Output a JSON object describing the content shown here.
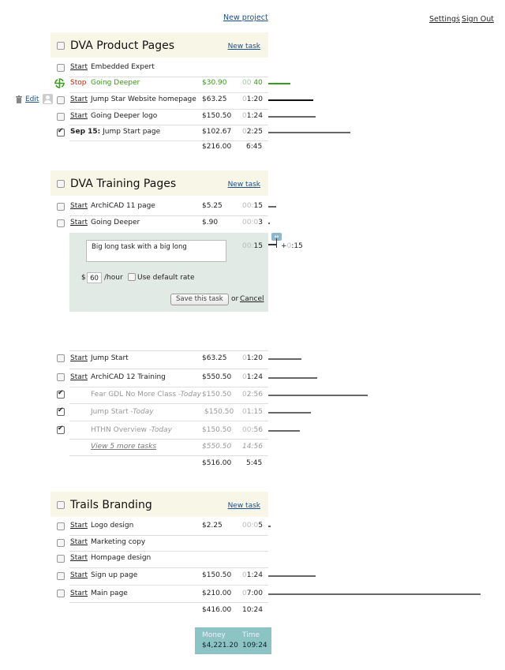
{
  "top": {
    "new_project": "New project",
    "settings": "Settings",
    "sign_out": "Sign Out"
  },
  "projects": [
    {
      "title": "DVA Product Pages",
      "new_task": "New task",
      "tasks": [
        {
          "start": "Start",
          "name": "Embedded Expert",
          "money": "",
          "time_dim": "",
          "time": ""
        },
        {
          "start": "Stop",
          "name": "Going Deeper",
          "money": "$30.90",
          "time_dim": "00",
          "time": " 40"
        },
        {
          "start": "Start",
          "name": "Jump Star Website homepage",
          "money": "$63.25",
          "time_dim": "0",
          "time": "1:20"
        },
        {
          "start": "Start",
          "name": "Going Deeper logo",
          "money": "$150.50",
          "time_dim": "0",
          "time": "1:24"
        },
        {
          "date": "Sep 15:",
          "name": " Jump Start page",
          "money": "$102.67",
          "time_dim": "0",
          "time": "2:25"
        }
      ],
      "row_edit": "Edit",
      "total_money": "$216.00",
      "total_time": "6:45"
    },
    {
      "title": "DVA Training Pages",
      "new_task": "New task",
      "tasks": [
        {
          "start": "Start",
          "name": "ArchiCAD 11 page",
          "money": "$5.25",
          "time_dim": "00:",
          "time": "15"
        },
        {
          "start": "Start",
          "name": "Going Deeper",
          "money": "$.90",
          "time_dim": "00:0",
          "time": "3"
        }
      ],
      "edit": {
        "text": "Big long task with a big long",
        "time_dim": "00:",
        "time": "15",
        "adjust_plus": "+",
        "adjust_dim": "0",
        "adjust_time": ":15",
        "currency": "$",
        "rate": "60",
        "per_hour": "/hour",
        "default_rate": "Use default rate",
        "save": "Save this task",
        "or": "or",
        "cancel": "Cancel"
      },
      "tasks2": [
        {
          "start": "Start",
          "name": "Jump Start",
          "money": "$63.25",
          "time_dim": "0",
          "time": "1:20"
        },
        {
          "start": "Start",
          "name": "ArchiCAD 12 Training",
          "money": "$550.50",
          "time_dim": "0",
          "time": "1:24"
        }
      ],
      "done": [
        {
          "name": "Fear GDL No More Class ",
          "today": "-Today",
          "money": "$150.50",
          "time_dim": "0",
          "time": "2:56"
        },
        {
          "name": "Jump Start ",
          "today": "-Today",
          "money": "$150.50",
          "time_dim": "0",
          "time": "1:15"
        },
        {
          "name": "HTHN Overview ",
          "today": "-Today",
          "money": "$150.50",
          "time_dim": "00",
          "time": ":56"
        }
      ],
      "more": {
        "label": "View 5 more tasks",
        "money": "$550.50",
        "time": "14:56"
      },
      "total_money": "$516.00",
      "total_time": "5:45"
    },
    {
      "title": "Trails Branding",
      "new_task": "New task",
      "tasks": [
        {
          "start": "Start",
          "name": "Logo design",
          "money": "$2.25",
          "time_dim": "00:0",
          "time": "5"
        },
        {
          "start": "Start",
          "name": "Marketing copy",
          "money": "",
          "time_dim": "",
          "time": ""
        },
        {
          "start": "Start",
          "name": "Hompage design",
          "money": "",
          "time_dim": "",
          "time": ""
        },
        {
          "start": "Start",
          "name": "Sign up page",
          "money": "$150.50",
          "time_dim": "0",
          "time": "1:24"
        },
        {
          "start": "Start",
          "name": "Main page",
          "money": "$210.00",
          "time_dim": "0",
          "time": "7:00"
        }
      ],
      "total_money": "$416.00",
      "total_time": "10:24"
    }
  ],
  "grand_total": {
    "money_label": "Money",
    "time_label": "Time",
    "money": "$4,221.20",
    "time": "109:24"
  },
  "colors": {
    "header_bg": "#f8f6e6",
    "active_green": "#3a9a1a",
    "stop_red": "#cc2200",
    "edit_bg": "#e2eae5",
    "total_bg": "#8cc4c4"
  },
  "icons": {
    "trash": "trash-icon",
    "avatar": "avatar-icon",
    "spinner": "timer-spinner-icon",
    "drag": "drag-handle-icon"
  }
}
